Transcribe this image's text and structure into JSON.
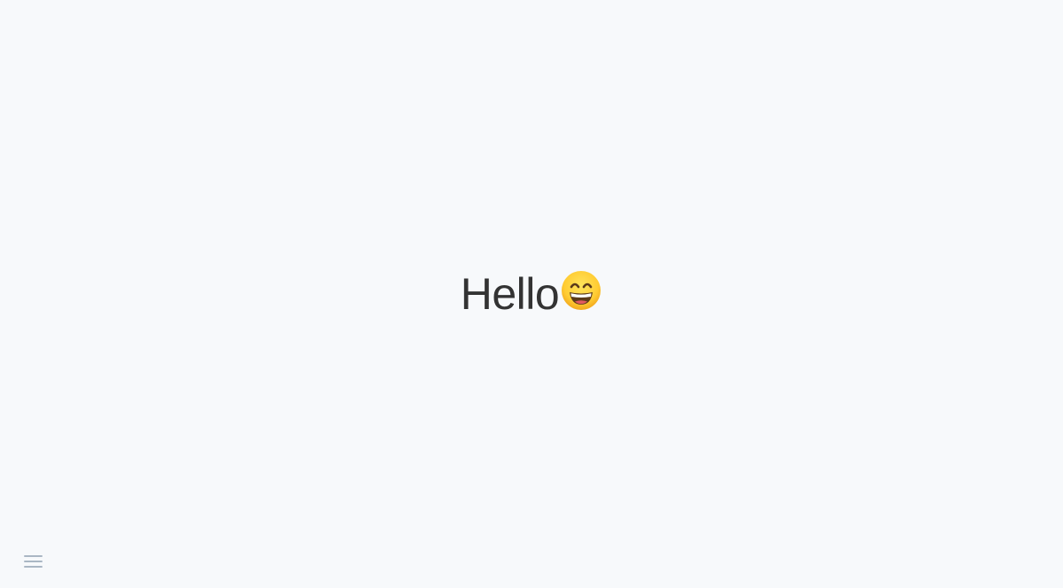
{
  "greeting": {
    "text": "Hello",
    "emoji_icon": "grinning-face-with-smiling-eyes-icon"
  },
  "menu": {
    "icon": "hamburger-menu-icon"
  },
  "colors": {
    "background": "#f7f9fb",
    "text": "#333333",
    "menu_icon": "#aab7c4",
    "emoji_face": "#ffcc33"
  }
}
